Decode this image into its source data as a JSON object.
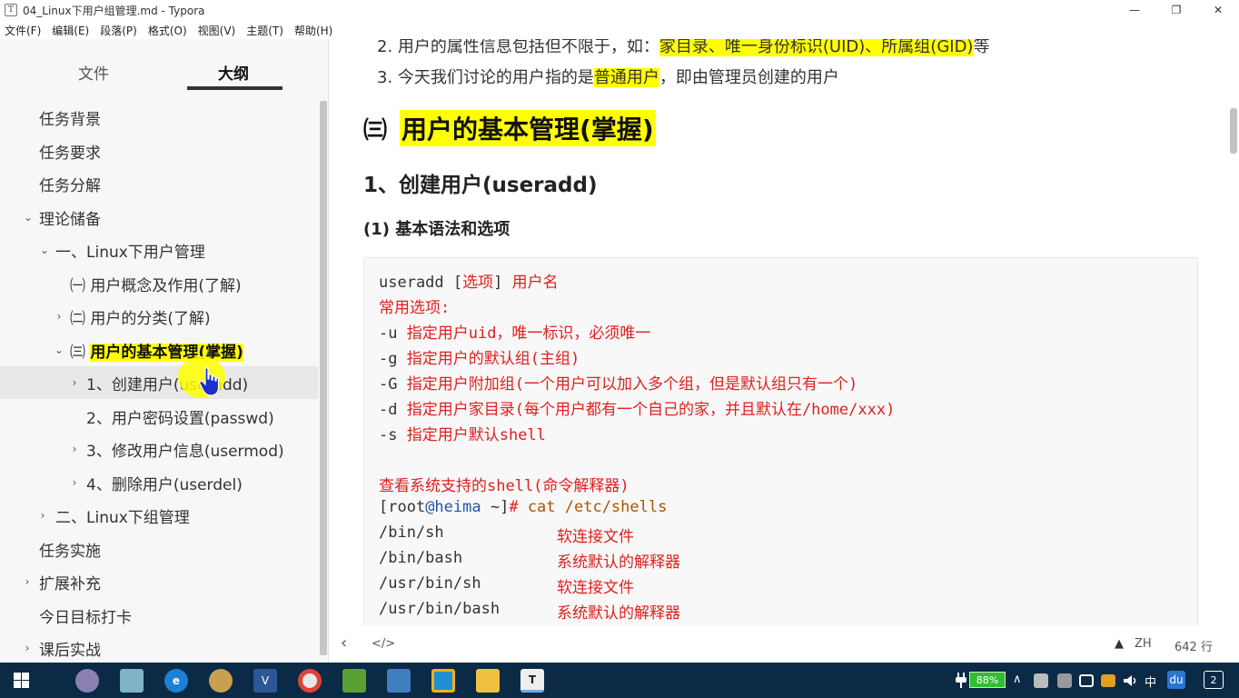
{
  "window": {
    "title": "04_Linux下用户组管理.md - Typora",
    "app_icon": "T",
    "min_glyph": "—",
    "restore_glyph": "❐",
    "close_glyph": "✕"
  },
  "menu": [
    "文件(F)",
    "编辑(E)",
    "段落(P)",
    "格式(O)",
    "视图(V)",
    "主题(T)",
    "帮助(H)"
  ],
  "sidebar": {
    "tab_files": "文件",
    "tab_outline": "大纲",
    "items": [
      {
        "label": "任务背景",
        "chev": ""
      },
      {
        "label": "任务要求",
        "chev": ""
      },
      {
        "label": "任务分解",
        "chev": ""
      },
      {
        "label": "理论储备",
        "chev": "⌄"
      },
      {
        "label": "一、Linux下用户管理",
        "chev": "⌄"
      },
      {
        "label": "㈠ 用户概念及作用(了解)",
        "chev": ""
      },
      {
        "label": "㈡ 用户的分类(了解)",
        "chev": "›"
      },
      {
        "label_prefix": "㈢ ",
        "label": "用户的基本管理(掌握)",
        "chev": "⌄"
      },
      {
        "label": "1、创建用户(useradd)",
        "chev": "›"
      },
      {
        "label": "2、用户密码设置(passwd)",
        "chev": ""
      },
      {
        "label": "3、修改用户信息(usermod)",
        "chev": "›"
      },
      {
        "label": "4、删除用户(userdel)",
        "chev": "›"
      },
      {
        "label": "二、Linux下组管理",
        "chev": "›"
      },
      {
        "label": "任务实施",
        "chev": ""
      },
      {
        "label": "扩展补充",
        "chev": "›"
      },
      {
        "label": "今日目标打卡",
        "chev": ""
      },
      {
        "label": "课后实战",
        "chev": "›"
      }
    ]
  },
  "editor": {
    "line2_prefix": "2. 用户的属性信息包括但不限于，如：",
    "line2_hl": "家目录、唯一身份标识(UID)、所属组(GID)",
    "line2_suffix": "等",
    "line3_prefix": "3. 今天我们讨论的用户指的是",
    "line3_hl": "普通用户",
    "line3_suffix": "，即由管理员创建的用户",
    "h2_prefix": "㈢",
    "h2": "用户的基本管理(掌握)",
    "h3": "1、创建用户(useradd)",
    "h4": "(1) 基本语法和选项",
    "code": {
      "l1_cmd": "useradd [",
      "l1_opt": "选项",
      "l1_mid": "] ",
      "l1_user": "用户名",
      "l2": "常用选项:",
      "l3_flag": "-u ",
      "l3_desc": "指定用户uid，唯一标识，必须唯一",
      "l4_flag": "-g ",
      "l4_desc": "指定用户的默认组(主组)",
      "l5_flag": "-G ",
      "l5_desc": "指定用户附加组(一个用户可以加入多个组，但是默认组只有一个)",
      "l6_flag": "-d ",
      "l6_desc": "指定用户家目录(每个用户都有一个自己的家，并且默认在/home/xxx)",
      "l7_flag": "-s ",
      "l7_desc": "指定用户默认shell",
      "l9": "查看系统支持的shell(命令解释器)",
      "prompt_open": "[root",
      "prompt_host": "@heima",
      "prompt_tail": " ~]",
      "prompt_hash": "# ",
      "prompt_cmd": "cat /etc/shells",
      "shells": [
        {
          "path": "/bin/sh",
          "desc": "软连接文件"
        },
        {
          "path": "/bin/bash",
          "desc": "系统默认的解释器"
        },
        {
          "path": "/usr/bin/sh",
          "desc": "软连接文件"
        },
        {
          "path": "/usr/bin/bash",
          "desc": "系统默认的解释器"
        }
      ]
    }
  },
  "statusbar": {
    "back": "‹",
    "source": "</>",
    "warn": "▲",
    "ime": "ZH",
    "lines": "642 行"
  },
  "taskbar": {
    "battery": "88%",
    "ime": "中",
    "du": "du",
    "notif_count": "2",
    "chevron_up": "∧"
  }
}
